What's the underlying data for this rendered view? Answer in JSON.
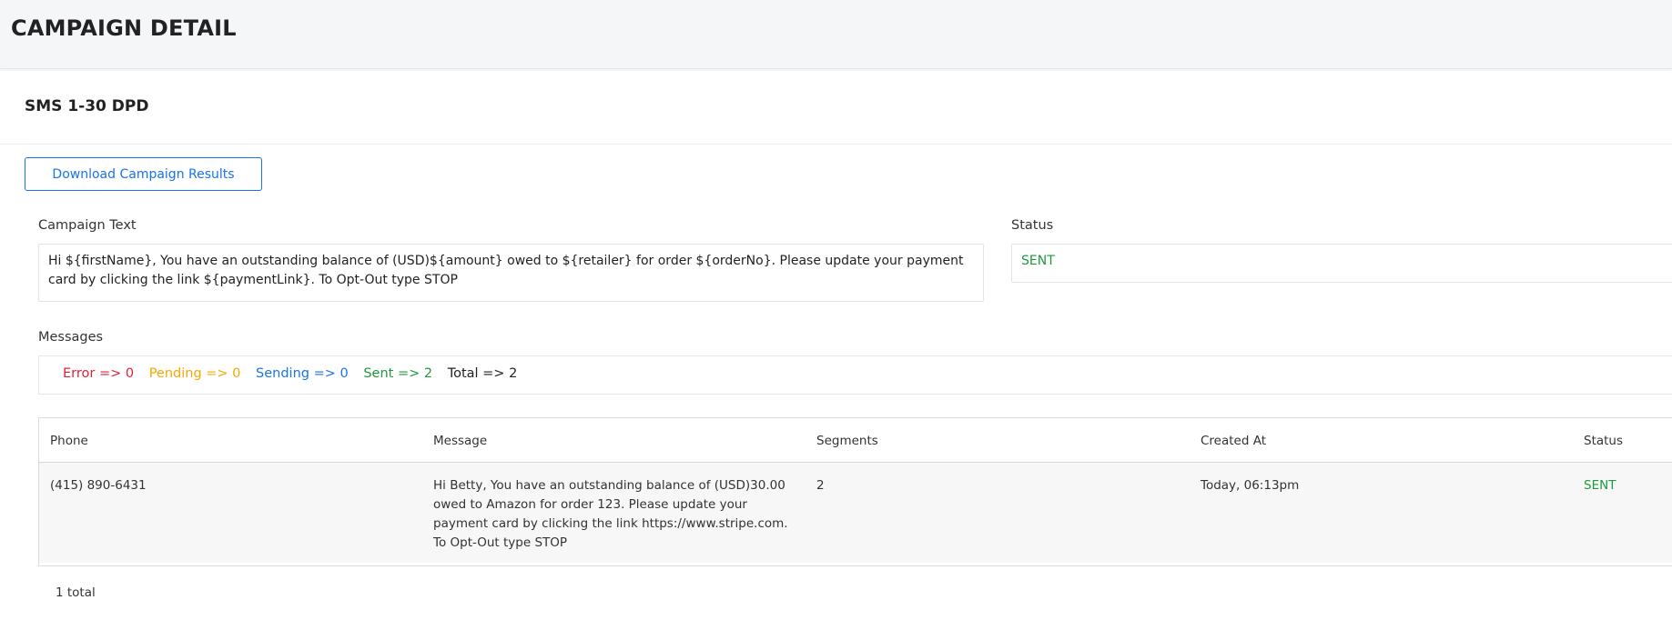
{
  "header": {
    "title": "CAMPAIGN DETAIL"
  },
  "campaign": {
    "name": "SMS 1-30 DPD",
    "download_label": "Download Campaign Results",
    "text_label": "Campaign Text",
    "text": "Hi ${firstName}, You have an outstanding balance of (USD)${amount} owed to ${retailer} for order ${orderNo}. Please update your payment card by clicking the link ${paymentLink}. To Opt-Out type STOP",
    "status_label": "Status",
    "status": "SENT",
    "status_color": "#1e9a3c"
  },
  "messages": {
    "label": "Messages",
    "counts": {
      "error": "Error => 0",
      "pending": "Pending => 0",
      "sending": "Sending => 0",
      "sent": "Sent => 2",
      "total": "Total => 2"
    },
    "colors": {
      "error": "#e0223a",
      "pending": "#f5a800",
      "sending": "#1a73e8",
      "sent": "#1e9a3c"
    }
  },
  "table": {
    "columns": [
      "Phone",
      "Message",
      "Segments",
      "Created At",
      "Status"
    ],
    "rows": [
      {
        "phone": "(415) 890-6431",
        "message": "Hi Betty, You have an outstanding balance of (USD)30.00 owed to Amazon for order 123. Please update your payment card by clicking the link https://www.stripe.com. To Opt-Out type STOP",
        "segments": "2",
        "created_at": "Today, 06:13pm",
        "status": "SENT"
      }
    ],
    "total_label": "1 total"
  }
}
